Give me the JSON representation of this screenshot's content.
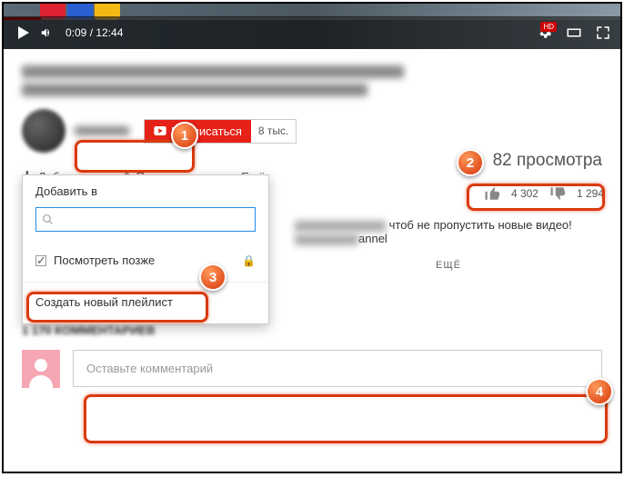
{
  "player": {
    "time": "0:09 / 12:44",
    "hd": "HD"
  },
  "channel": {
    "subscribe_label": "Подписаться",
    "sub_count": "8 тыс."
  },
  "views": "82 просмотра",
  "actions": {
    "add": "Добавить в",
    "share": "Поделиться",
    "more": "Ещё"
  },
  "likes": "4 302",
  "dislikes": "1 294",
  "dropdown": {
    "title": "Добавить в",
    "search_placeholder": "",
    "watch_later": "Посмотреть позже",
    "create": "Создать новый плейлист"
  },
  "description": {
    "line1_suffix": " чтоб не пропустить новые видео!",
    "line2_suffix": "annel",
    "more": "ЕЩЁ"
  },
  "comments_header": "1 170 КОММЕНТАРИЕВ",
  "comment_placeholder": "Оставьте комментарий",
  "callouts": {
    "c1": "1",
    "c2": "2",
    "c3": "3",
    "c4": "4"
  }
}
